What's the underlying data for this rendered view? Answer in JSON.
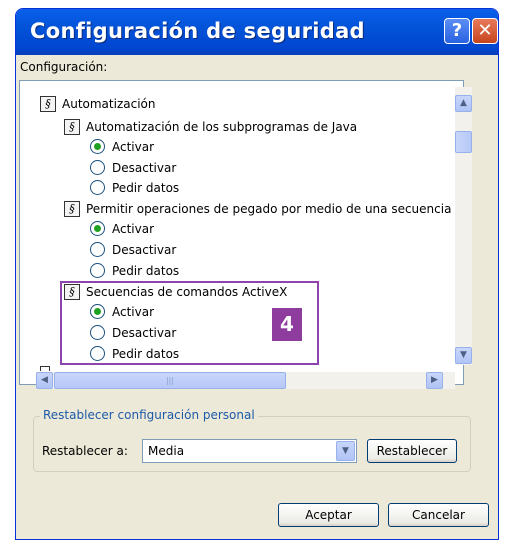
{
  "window": {
    "title": "Configuración de seguridad",
    "help_glyph": "?",
    "close_glyph": "✕"
  },
  "config_label": "Configuración:",
  "tree": {
    "category": "Automatización",
    "groups": [
      {
        "label": "Automatización de los subprogramas de Java",
        "options": [
          "Activar",
          "Desactivar",
          "Pedir datos"
        ],
        "selected": "Activar"
      },
      {
        "label": "Permitir operaciones de pegado por medio de una secuencia c",
        "options": [
          "Activar",
          "Desactivar",
          "Pedir datos"
        ],
        "selected": "Activar"
      },
      {
        "label": "Secuencias de comandos ActiveX",
        "options": [
          "Activar",
          "Desactivar",
          "Pedir datos"
        ],
        "selected": "Activar"
      }
    ]
  },
  "annotation": {
    "step_number": "4",
    "color": "#8E3D9E"
  },
  "reset_group": {
    "legend": "Restablecer configuración personal",
    "label": "Restablecer a:",
    "selected_value": "Media",
    "button": "Restablecer"
  },
  "footer": {
    "ok": "Aceptar",
    "cancel": "Cancelar"
  },
  "colors": {
    "titlebar": "#0353D8",
    "dialog_bg": "#ECE9D8",
    "radio_selected": "#21A121",
    "legend_text": "#1E5AA8"
  }
}
